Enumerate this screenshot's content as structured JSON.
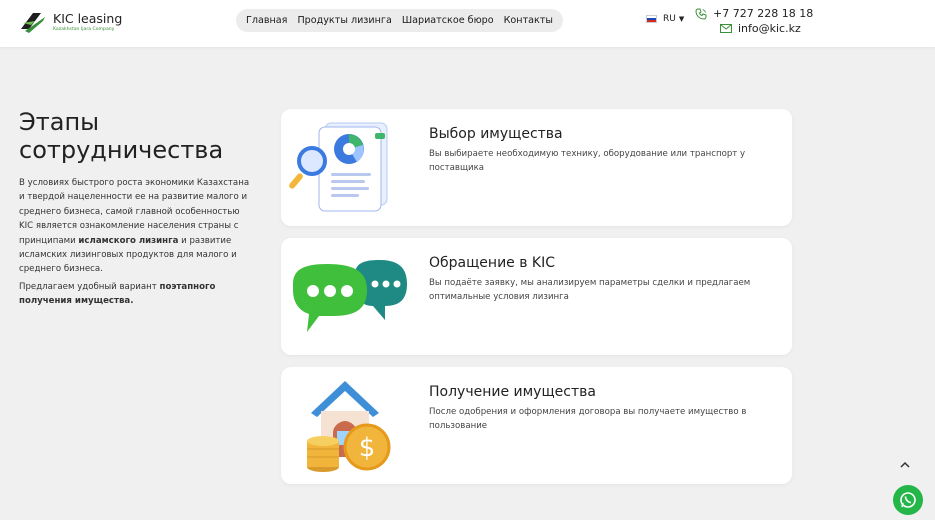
{
  "header": {
    "logo_title": "KIC leasing",
    "logo_subtitle": "Kazakhstan Ijara Company",
    "nav": [
      "Главная",
      "Продукты лизинга",
      "Шариатское бюро",
      "Контакты"
    ],
    "language": "RU",
    "phone": "+7 727 228 18 18",
    "email": "info@kic.kz"
  },
  "intro": {
    "title": "Этапы сотрудничества",
    "para1_a": "В условиях быстрого роста экономики Казахстана и твердой нацеленности ее на развитие малого и среднего бизнеса, самой главной особенностью KIC является ознакомление населения страны с принципами ",
    "para1_bold": "исламского лизинга",
    "para1_b": " и развитие исламских лизинговых продуктов для малого и среднего бизнеса.",
    "para2_a": "Предлагаем удобный вариант ",
    "para2_bold": "поэтапного получения имущества."
  },
  "steps": [
    {
      "title": "Выбор имущества",
      "desc": "Вы выбираете необходимую технику, оборудование или транспорт у поставщика",
      "icon": "document-magnifier-icon"
    },
    {
      "title": "Обращение в KIC",
      "desc": "Вы подаёте заявку, мы анализируем параметры сделки и предлагаем оптимальные условия лизинга",
      "icon": "chat-bubbles-icon"
    },
    {
      "title": "Получение имущества",
      "desc": "После одобрения и оформления договора вы получаете имущество в пользование",
      "icon": "house-coins-icon"
    }
  ],
  "colors": {
    "brand_green": "#3a8f3a",
    "whatsapp": "#25b64a"
  }
}
